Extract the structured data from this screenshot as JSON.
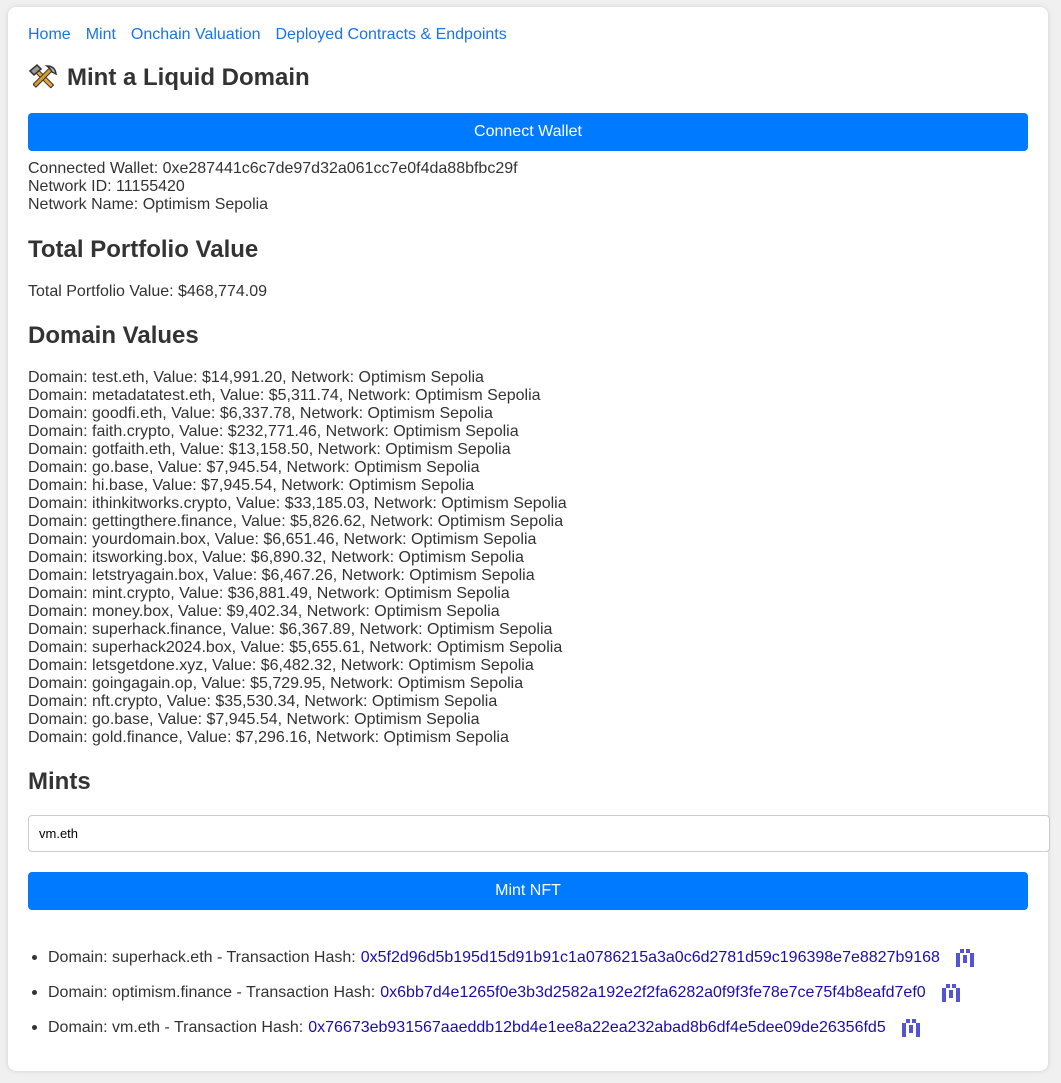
{
  "nav": {
    "items": [
      "Home",
      "Mint",
      "Onchain Valuation",
      "Deployed Contracts & Endpoints"
    ]
  },
  "header": {
    "icon": "hammer-and-pick-icon",
    "title": "Mint a Liquid Domain"
  },
  "wallet": {
    "connect_label": "Connect Wallet",
    "connected_line": "Connected Wallet: 0xe287441c6c7de97d32a061cc7e0f4da88bfbc29f",
    "network_id_line": "Network ID: 11155420",
    "network_name_line": "Network Name: Optimism Sepolia"
  },
  "portfolio": {
    "heading": "Total Portfolio Value",
    "line": "Total Portfolio Value: $468,774.09"
  },
  "domains": {
    "heading": "Domain Values",
    "items": [
      "Domain: test.eth, Value: $14,991.20, Network: Optimism Sepolia",
      "Domain: metadatatest.eth, Value: $5,311.74, Network: Optimism Sepolia",
      "Domain: goodfi.eth, Value: $6,337.78, Network: Optimism Sepolia",
      "Domain: faith.crypto, Value: $232,771.46, Network: Optimism Sepolia",
      "Domain: gotfaith.eth, Value: $13,158.50, Network: Optimism Sepolia",
      "Domain: go.base, Value: $7,945.54, Network: Optimism Sepolia",
      "Domain: hi.base, Value: $7,945.54, Network: Optimism Sepolia",
      "Domain: ithinkitworks.crypto, Value: $33,185.03, Network: Optimism Sepolia",
      "Domain: gettingthere.finance, Value: $5,826.62, Network: Optimism Sepolia",
      "Domain: yourdomain.box, Value: $6,651.46, Network: Optimism Sepolia",
      "Domain: itsworking.box, Value: $6,890.32, Network: Optimism Sepolia",
      "Domain: letstryagain.box, Value: $6,467.26, Network: Optimism Sepolia",
      "Domain: mint.crypto, Value: $36,881.49, Network: Optimism Sepolia",
      "Domain: money.box, Value: $9,402.34, Network: Optimism Sepolia",
      "Domain: superhack.finance, Value: $6,367.89, Network: Optimism Sepolia",
      "Domain: superhack2024.box, Value: $5,655.61, Network: Optimism Sepolia",
      "Domain: letsgetdone.xyz, Value: $6,482.32, Network: Optimism Sepolia",
      "Domain: goingagain.op, Value: $5,729.95, Network: Optimism Sepolia",
      "Domain: nft.crypto, Value: $35,530.34, Network: Optimism Sepolia",
      "Domain: go.base, Value: $7,945.54, Network: Optimism Sepolia",
      "Domain: gold.finance, Value: $7,296.16, Network: Optimism Sepolia"
    ]
  },
  "mints": {
    "heading": "Mints",
    "input_value": "vm.eth",
    "mint_label": "Mint NFT",
    "items": [
      {
        "prefix": "Domain: superhack.eth - Transaction Hash:",
        "hash": "0x5f2d96d5b195d15d91b91c1a0786215a3a0c6d2781d59c196398e7e8827b9168",
        "icon": "blockscout-explorer-icon"
      },
      {
        "prefix": "Domain: optimism.finance - Transaction Hash:",
        "hash": "0x6bb7d4e1265f0e3b3d2582a192e2f2fa6282a0f9f3fe78e7ce75f4b8eafd7ef0",
        "icon": "blockscout-explorer-icon"
      },
      {
        "prefix": "Domain: vm.eth - Transaction Hash:",
        "hash": "0x76673eb931567aaeddb12bd4e1ee8a22ea232abad8b6df4e5dee09de26356fd5",
        "icon": "blockscout-explorer-icon"
      }
    ]
  },
  "colors": {
    "primary": "#007bff",
    "link": "#1a73e8",
    "hash_link": "#1a0dab",
    "explorer_icon": "#5353d3"
  }
}
